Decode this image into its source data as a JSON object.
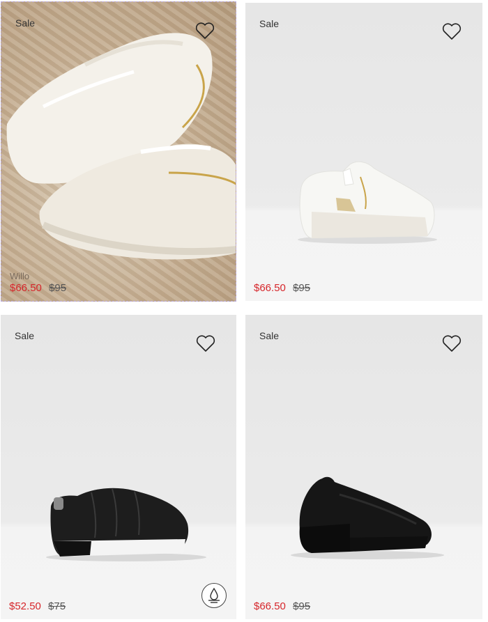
{
  "products": [
    {
      "badge": "Sale",
      "name": "Willo",
      "price_now": "$66.50",
      "price_was": "$95",
      "heart_icon": "heart-outline-icon"
    },
    {
      "badge": "Sale",
      "price_now": "$66.50",
      "price_was": "$95",
      "heart_icon": "heart-outline-icon"
    },
    {
      "badge": "Sale",
      "price_now": "$52.50",
      "price_was": "$75",
      "heart_icon": "heart-outline-icon",
      "feature_icon": "water-resistant-icon"
    },
    {
      "badge": "Sale",
      "price_now": "$66.50",
      "price_was": "$95",
      "heart_icon": "heart-outline-icon"
    }
  ],
  "colors": {
    "sale_price": "#d6262b",
    "original_price": "#555555"
  }
}
